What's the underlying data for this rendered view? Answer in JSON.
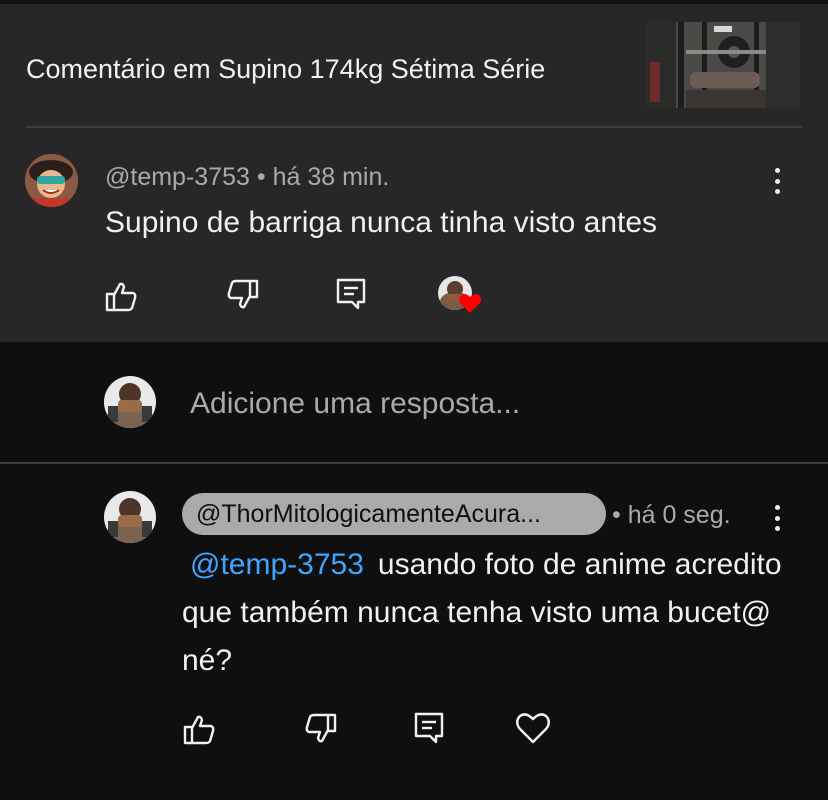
{
  "header": {
    "title": "Comentário em Supino 174kg Sétima Série"
  },
  "comment": {
    "author": "@temp-3753",
    "separator": " • ",
    "time": "há 38 min.",
    "text": "Supino de barriga nunca tinha visto antes"
  },
  "reply_box": {
    "placeholder": "Adicione uma resposta..."
  },
  "reply": {
    "author": "@ThorMitologicamenteAcura...",
    "time": "• há 0 seg.",
    "mention": "@temp-3753",
    "text": "usando foto de anime acredito que também nunca tenha visto uma bucet@ né?"
  },
  "icons": [
    "like-icon",
    "dislike-icon",
    "reply-icon",
    "creator-heart-icon",
    "heart-outline-icon",
    "more-vert-icon"
  ],
  "colors": {
    "header_bg": "#272727",
    "page_bg": "#0f0f0f",
    "mention": "#3ea6ff",
    "heart": "#ff0000",
    "pill_bg": "#aaaaaa"
  }
}
